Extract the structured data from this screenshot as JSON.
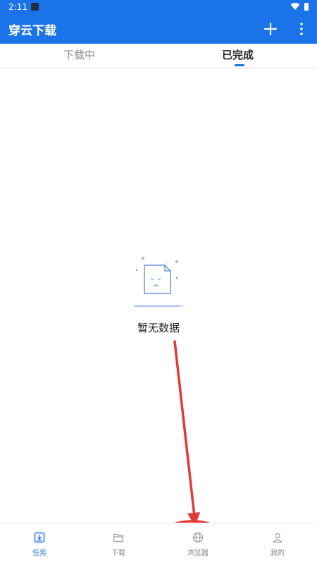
{
  "status_bar": {
    "time": "2:11"
  },
  "app_bar": {
    "title": "穿云下载",
    "add_icon": "plus-icon",
    "more_icon": "more-vertical-icon"
  },
  "tabs": [
    {
      "label": "下载中",
      "selected": false
    },
    {
      "label": "已完成",
      "selected": true
    }
  ],
  "empty_state": {
    "icon": "empty-document-icon",
    "text": "暂无数据"
  },
  "bottom_nav": [
    {
      "label": "任务",
      "icon": "task-download-icon",
      "active": true
    },
    {
      "label": "下载",
      "icon": "folder-icon",
      "active": false
    },
    {
      "label": "浏览器",
      "icon": "globe-icon",
      "active": false
    },
    {
      "label": "我的",
      "icon": "profile-icon",
      "active": false
    }
  ],
  "colors": {
    "primary": "#1a73e8",
    "annotation": "#e53935"
  }
}
